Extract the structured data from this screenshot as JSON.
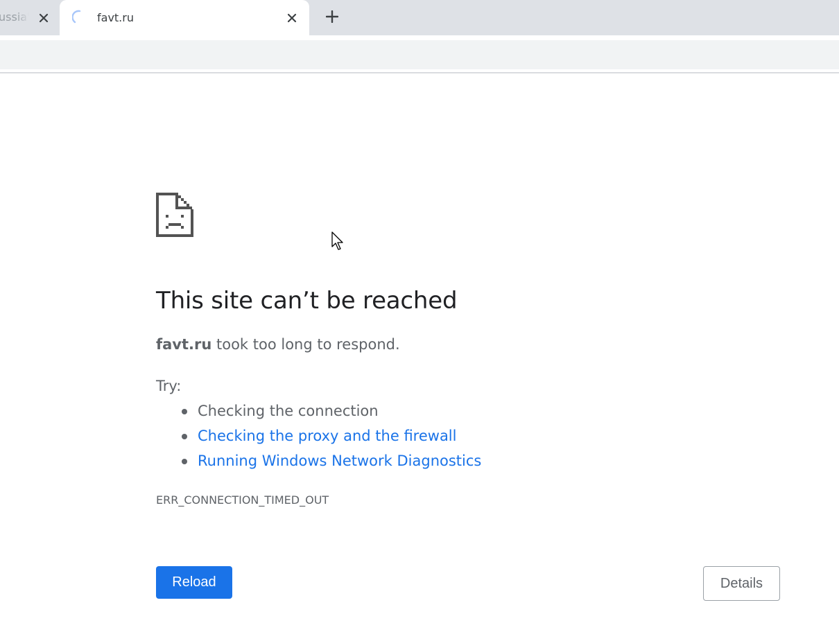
{
  "tabs": [
    {
      "title": "ussia's",
      "state": "inactive"
    },
    {
      "title": "favt.ru",
      "state": "active-loading"
    }
  ],
  "icons": {
    "close": "close-icon",
    "new_tab": "plus-icon",
    "loading": "loading-spinner-icon",
    "error": "sad-page-icon",
    "cursor": "mouse-pointer-icon"
  },
  "error_page": {
    "heading": "This site can’t be reached",
    "host": "favt.ru",
    "message_suffix": " took too long to respond.",
    "try_label": "Try:",
    "suggestions": [
      {
        "text": "Checking the connection",
        "is_link": false
      },
      {
        "text": "Checking the proxy and the firewall",
        "is_link": true
      },
      {
        "text": "Running Windows Network Diagnostics",
        "is_link": true
      }
    ],
    "error_code": "ERR_CONNECTION_TIMED_OUT",
    "reload_label": "Reload",
    "details_label": "Details"
  },
  "colors": {
    "accent": "#1a73e8",
    "text_primary": "#202124",
    "text_secondary": "#5f6368",
    "tabstrip": "#dee1e6",
    "toolbar": "#f1f3f4"
  }
}
